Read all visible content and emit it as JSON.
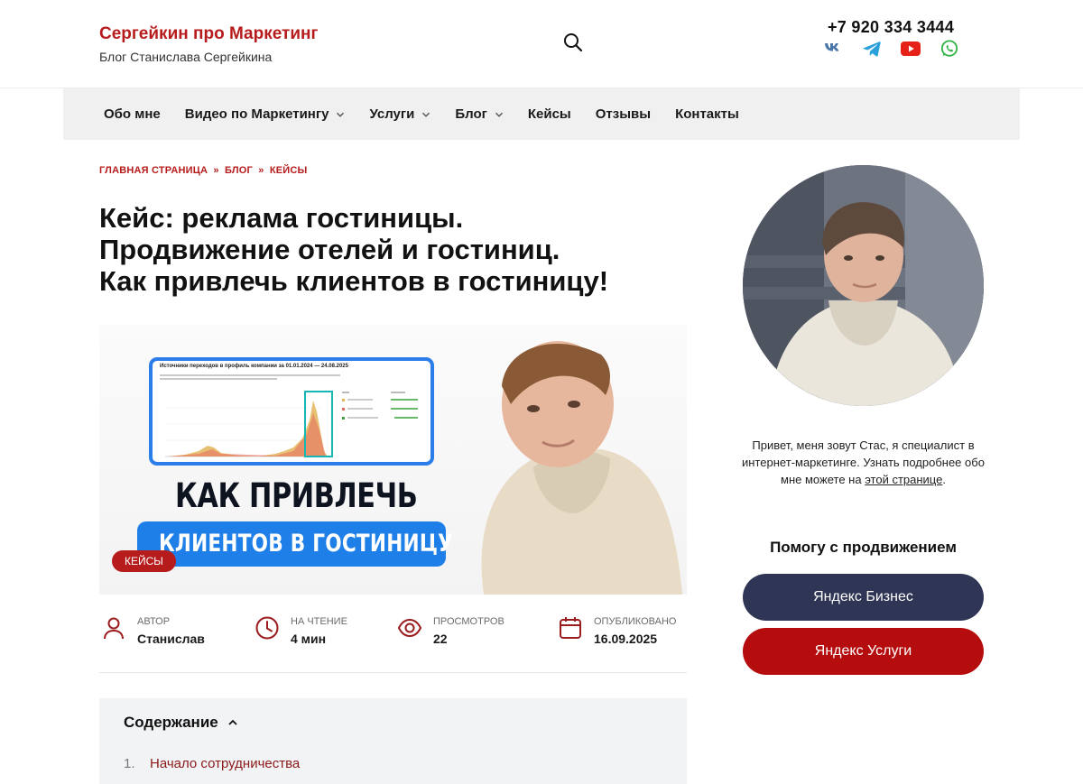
{
  "header": {
    "site_title": "Сергейкин про Маркетинг",
    "site_description": "Блог Станислава Сергейкина",
    "phone": "+7 920 334 3444",
    "search_icon": "search-icon",
    "socials": [
      {
        "name": "vk-icon",
        "color": "#4a76a8"
      },
      {
        "name": "telegram-icon",
        "color": "#2aa1da"
      },
      {
        "name": "youtube-icon",
        "color": "#e62117"
      },
      {
        "name": "whatsapp-icon",
        "color": "#2fb344"
      }
    ]
  },
  "nav": {
    "items": [
      {
        "label": "Обо мне",
        "dropdown": false
      },
      {
        "label": "Видео по Маркетингу",
        "dropdown": true
      },
      {
        "label": "Услуги",
        "dropdown": true
      },
      {
        "label": "Блог",
        "dropdown": true
      },
      {
        "label": "Кейсы",
        "dropdown": false
      },
      {
        "label": "Отзывы",
        "dropdown": false
      },
      {
        "label": "Контакты",
        "dropdown": false
      }
    ]
  },
  "breadcrumb": {
    "home": "ГЛАВНАЯ СТРАНИЦА",
    "separator": "»",
    "blog": "БЛОГ",
    "current": "КЕЙСЫ"
  },
  "article": {
    "title_lines": [
      "Кейс: реклама гостиницы.",
      "Продвижение отелей и гостиниц.",
      "Как привлечь клиентов в гостиницу!"
    ],
    "hero": {
      "chart_title": "Источники переходов в профиль компании за 01.01.2024 — 24.08.2025",
      "line1": "КАК ПРИВЛЕЧЬ",
      "line2": "КЛИЕНТОВ В ГОСТИНИЦУ"
    },
    "category": "КЕЙСЫ",
    "meta": [
      {
        "icon": "user-icon",
        "label": "АВТОР",
        "value": "Станислав"
      },
      {
        "icon": "clock-icon",
        "label": "НА ЧТЕНИЕ",
        "value": "4 мин"
      },
      {
        "icon": "eye-icon",
        "label": "ПРОСМОТРОВ",
        "value": "22"
      },
      {
        "icon": "calendar-icon",
        "label": "ОПУБЛИКОВАНО",
        "value": "16.09.2025"
      }
    ]
  },
  "toc": {
    "title": "Содержание",
    "items": [
      {
        "num": "1.",
        "label": "Начало сотрудничества"
      }
    ]
  },
  "sidebar": {
    "bio_text": "Привет, меня зовут Стас, я специалист в интернет-маркетинге. Узнать подробнее обо мне можете на ",
    "bio_link": "этой странице",
    "bio_end": ".",
    "help_title": "Помогу с продвижением",
    "btn_business": "Яндекс Бизнес",
    "btn_services": "Яндекс Услуги"
  },
  "colors": {
    "accent": "#b71c1c",
    "nav_bg": "#f0f0f0",
    "button_dark": "#2f3554",
    "button_red": "#b50d0d",
    "toc_bg": "#f1f3f5"
  }
}
